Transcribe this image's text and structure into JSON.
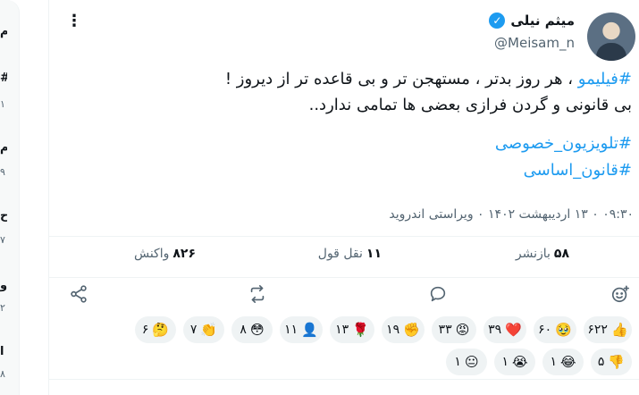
{
  "sidebar_fragments": [
    "م",
    "#",
    "۱",
    "م",
    "۹",
    "ح",
    "۷",
    "و",
    "۲",
    "ا",
    "۸"
  ],
  "author": {
    "name": "میثم نیلی",
    "handle": "@Meisam_n",
    "verified_mark": "✓"
  },
  "menu_icon": "⋮",
  "text": {
    "hashtag": "#فیلیمو",
    "line1_rest": " ، هر روز بدتر ، مستهجن تر و بی قاعده تر از دیروز !",
    "line2": "بی قانونی و گردن فرازی  بعضی ها تمامی ندارد..",
    "tag1": "#تلویزیون_خصوصی",
    "tag2": "#قانون_اساسی"
  },
  "meta": "۰۹:۳۰ ۰ ۱۳ اردیبهشت ۱۴۰۲ ۰ ویراستی اندروید",
  "stats": {
    "reposts_count": "۵۸",
    "reposts_label": "بازنشر",
    "quotes_count": "۱۱",
    "quotes_label": "نقل قول",
    "reactions_count": "۸۲۶",
    "reactions_label": "واکنش"
  },
  "action_icons": [
    "add-reaction-icon",
    "reply-icon",
    "repost-icon",
    "share-icon"
  ],
  "reactions_row1": [
    {
      "emoji": "👍",
      "count": "۶۲۲"
    },
    {
      "emoji": "🥹",
      "count": "۶۰"
    },
    {
      "emoji": "❤️",
      "count": "۳۹"
    },
    {
      "emoji": "😡",
      "count": "۳۳"
    },
    {
      "emoji": "✊",
      "count": "۱۹"
    },
    {
      "emoji": "🌹",
      "count": "۱۳"
    },
    {
      "emoji": "👤",
      "count": "۱۱"
    },
    {
      "emoji": "😳",
      "count": "۸"
    },
    {
      "emoji": "👏",
      "count": "۷"
    },
    {
      "emoji": "🤔",
      "count": "۶"
    }
  ],
  "reactions_row2": [
    {
      "emoji": "👎",
      "count": "۵"
    },
    {
      "emoji": "😂",
      "count": "۱"
    },
    {
      "emoji": "😭",
      "count": "۱"
    },
    {
      "emoji": "😐",
      "count": "۱"
    }
  ],
  "colors": {
    "accent": "#1d9bf0",
    "muted": "#536471",
    "chip_bg": "#eff3f4"
  }
}
